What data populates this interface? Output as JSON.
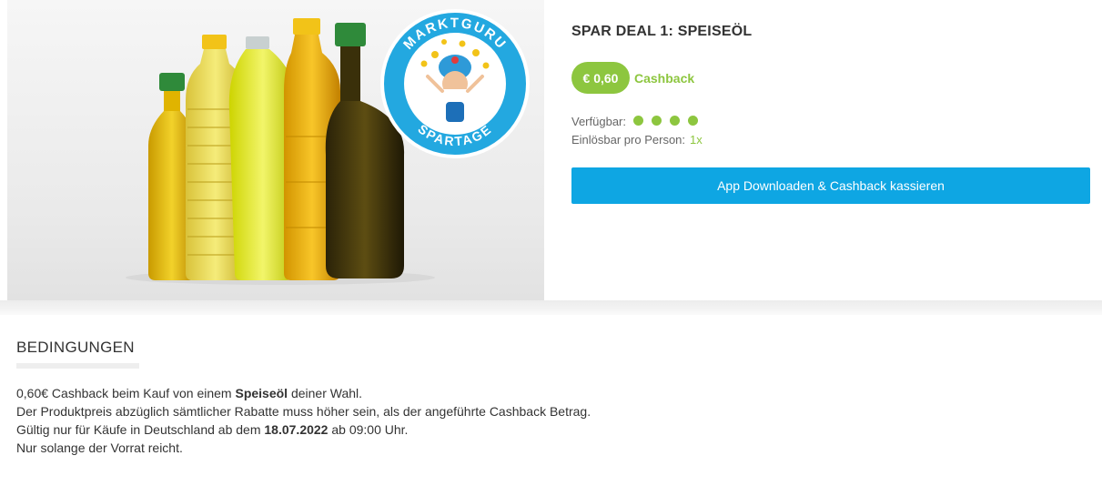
{
  "hero": {
    "badge_top_text": "MARKTGURU",
    "badge_bottom_text": "SPARTAGE",
    "colors": {
      "badge_blue": "#23a8e0",
      "oil_yellow": "#d8b800",
      "cap_green": "#2f8a3a",
      "cap_yellow": "#f2c318"
    }
  },
  "deal": {
    "title": "SPAR DEAL 1: SPEISEÖL",
    "price": "€ 0,60",
    "cashback_label": "Cashback",
    "available_label": "Verfügbar:",
    "available_level": 4,
    "per_person_label": "Einlösbar pro Person:",
    "per_person_value": "1x",
    "cta_label": "App Downloaden & Cashback kassieren"
  },
  "conditions": {
    "title": "BEDINGUNGEN",
    "line1_a": "0,60€ Cashback beim Kauf von einem ",
    "line1_bold": "Speiseöl",
    "line1_b": " deiner Wahl.",
    "line2": "Der Produktpreis abzüglich sämtlicher Rabatte muss höher sein, als der angeführte Cashback Betrag.",
    "line3_a": "Gültig nur für Käufe in Deutschland ab dem ",
    "line3_bold": "18.07.2022",
    "line3_b": " ab 09:00 Uhr.",
    "line4": "Nur solange der Vorrat reicht."
  },
  "colors": {
    "accent_green": "#8dc63f",
    "cta_blue": "#0ea6e3"
  }
}
